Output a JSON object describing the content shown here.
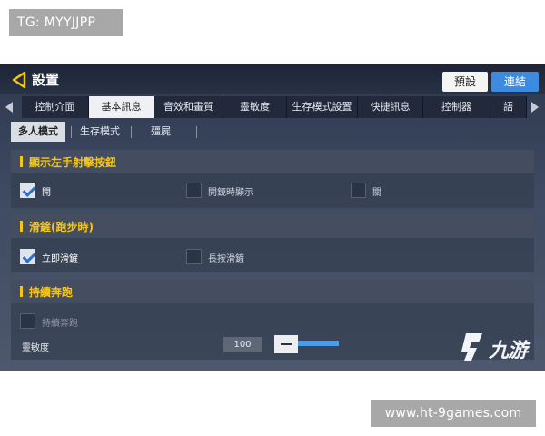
{
  "watermarks": {
    "top": "TG: MYYJJPP",
    "bottom": "www.ht-9games.com"
  },
  "header": {
    "title": "設置",
    "preset_label": "預設",
    "link_label": "連結"
  },
  "tabs": [
    {
      "label": "控制介面"
    },
    {
      "label": "基本訊息"
    },
    {
      "label": "音效和畫質"
    },
    {
      "label": "靈敏度"
    },
    {
      "label": "生存模式設置"
    },
    {
      "label": "快捷訊息"
    },
    {
      "label": "控制器"
    },
    {
      "label": "語"
    }
  ],
  "subtabs": [
    {
      "label": "多人模式"
    },
    {
      "label": "生存模式"
    },
    {
      "label": "殭屍"
    }
  ],
  "sections": [
    {
      "title": "顯示左手射擊按鈕",
      "options": [
        {
          "label": "開",
          "checked": true
        },
        {
          "label": "開鏡時顯示",
          "checked": false
        },
        {
          "label": "關",
          "checked": false
        }
      ]
    },
    {
      "title": "滑鏟(跑步時)",
      "options": [
        {
          "label": "立即滑鏟",
          "checked": true
        },
        {
          "label": "長按滑鏟",
          "checked": false
        }
      ]
    },
    {
      "title": "持續奔跑",
      "options": [
        {
          "label": "持續奔跑",
          "checked": false
        }
      ]
    }
  ],
  "sensitivity": {
    "label": "靈敏度",
    "value": "100"
  },
  "logo": {
    "text": "九游"
  },
  "colors": {
    "accent_yellow": "#f5c518",
    "primary_blue": "#3d8be0",
    "check_blue": "#2d6fd1"
  }
}
